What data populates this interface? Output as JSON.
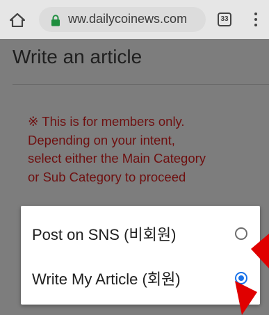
{
  "browser": {
    "url": "ww.dailycoinews.com",
    "tab_count": "33"
  },
  "page": {
    "title": "Write an article",
    "notice_lines": [
      "※ This is for members only.",
      "Depending on your intent,",
      "select either the Main Category",
      "or Sub Category to proceed"
    ]
  },
  "dialog": {
    "options": [
      {
        "label": "Post on SNS (비회원)",
        "selected": false
      },
      {
        "label": "Write My Article (회원)",
        "selected": true
      }
    ]
  },
  "colors": {
    "notice_text": "#6e1010",
    "radio_selected": "#1a73e8",
    "annotation_arrow": "#e00000"
  },
  "icons": {
    "home": "home-icon",
    "lock": "lock-icon",
    "tabs": "tabs-icon",
    "menu": "more-vert-icon",
    "radio_unchecked": "radio-unchecked-icon",
    "radio_checked": "radio-checked-icon",
    "arrow": "red-arrow-icon"
  }
}
